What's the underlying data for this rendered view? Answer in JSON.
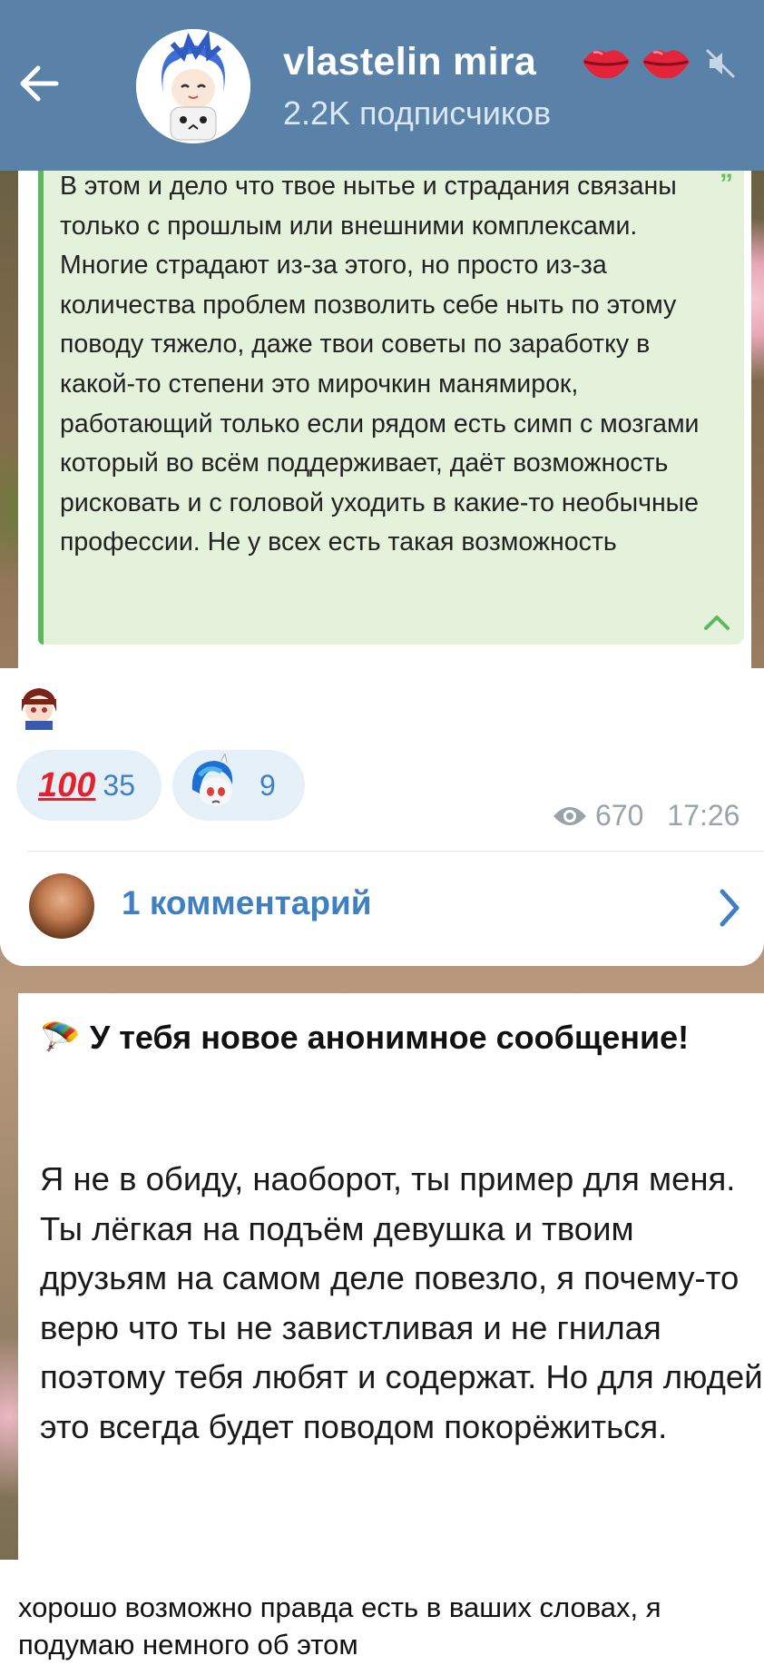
{
  "header": {
    "title": "vlastelin mira",
    "subscribers": "2.2K подписчиков",
    "icons": [
      "back-arrow-icon",
      "channel-avatar",
      "lips-icon",
      "lips-icon",
      "mute-icon"
    ]
  },
  "quote": {
    "text": "В этом и дело что твое нытье и страдания связаны только с прошлым или внешними комплексами. Многие страдают из-за этого, но просто из-за количества проблем позволить себе ныть по этому поводу тяжело, даже твои советы по заработку в какой-то степени это мирочкин манямирок, работающий только если рядом есть симп с мозгами который во всём поддерживает, даёт возможность рисковать и с головой уходить в какие-то необычные профессии. Не у всех есть такая возможность",
    "quote_mark": "”"
  },
  "reactions": [
    {
      "emoji": "💯",
      "count": "35"
    },
    {
      "emoji": "pony-sticker",
      "count": "9"
    }
  ],
  "meta": {
    "views": "670",
    "time": "17:26"
  },
  "comments": {
    "label": "1 комментарий"
  },
  "anon_message": {
    "emoji": "🪂",
    "heading": "У тебя новое анонимное сообщение!",
    "body": "Я не в обиду, наоборот, ты пример для меня. Ты лёгкая на подъём девушка и твоим друзьям на самом деле повезло, я почему-то верю что ты не завистливая и не гнилая поэтому тебя любят и содержат. Но для людей это всегда будет поводом покорёжиться."
  },
  "reply": {
    "text": "хорошо возможно правда есть в ваших словах, я подумаю немного об этом"
  },
  "colors": {
    "header_bg": "#5a82a8",
    "accent_blue": "#3f80c4",
    "quote_bg": "#e4f2dc",
    "quote_bar": "#5cb85c",
    "reaction_bg": "#e6f0f9"
  }
}
